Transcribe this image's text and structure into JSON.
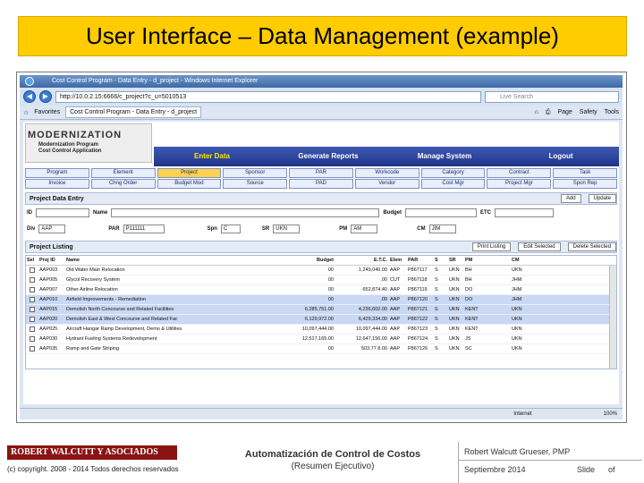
{
  "slide": {
    "title": "User Interface – Data Management (example)"
  },
  "browser": {
    "window_title": "Cost Control Program - Data Entry - d_project - Windows Internet Explorer",
    "address": "http://10.0.2.15:6666/c_project?c_u=5010513",
    "search_placeholder": "Live Search",
    "favorites": "Favorites",
    "tab_label": "Cost Control Program - Data Entry - d_project",
    "tools": [
      "Page",
      "Safety",
      "Tools"
    ],
    "status_internet": "Internet",
    "status_zoom": "100%"
  },
  "app": {
    "logo_title": "MODERNIZATION",
    "logo_sub1": "Modernization Program",
    "logo_sub2": "Cost Control Application",
    "menu": [
      "Enter Data",
      "Generate Reports",
      "Manage System",
      "Logout"
    ],
    "nav_row1": [
      "Program",
      "Element",
      "Project",
      "Sponsor",
      "PAR",
      "Workcode",
      "Category",
      "Contract",
      "Task"
    ],
    "nav_row2": [
      "Invoice",
      "Chng Order",
      "Budget Mod",
      "Source",
      "PAD",
      "Vendor",
      "Cost Mgr",
      "Project Mgr",
      "Spon Rep"
    ],
    "entry_title": "Project Data Entry",
    "add_label": "Add",
    "update_label": "Update",
    "fields_row1": {
      "id": "ID",
      "name": "Name",
      "budget": "Budget",
      "etc": "ETC"
    },
    "fields_row2": {
      "div": "Div",
      "div_val": "AAP",
      "par": "PAR",
      "par_val": "P111111",
      "spn": "Spn",
      "spn_val": "C",
      "sr": "SR",
      "sr_val": "UKN",
      "pm": "PM",
      "pm_val": "AM",
      "cm": "CM",
      "cm_val": "JIM"
    },
    "listing_title": "Project Listing",
    "print_label": "Print Listing",
    "edit_label": "Edit Selected",
    "delete_label": "Delete Selected",
    "columns": [
      "Sel",
      "Proj ID",
      "Name",
      "Budget",
      "E.T.C.",
      "Elem",
      "PAR",
      "S",
      "SR",
      "PM",
      "CM"
    ],
    "rows": [
      {
        "id": "AAP003",
        "name": "Old Water Main Relocation",
        "budget": "00",
        "etc": "1,249,040.00",
        "elem": "AAP",
        "par": "P867117",
        "s": "S",
        "sr": "UKN",
        "pm": "BH",
        "cm": "UKN",
        "hl": false
      },
      {
        "id": "AAP005",
        "name": "Glycol Recovery System",
        "budget": "00",
        "etc": ".00",
        "elem": "CUT",
        "par": "P867118",
        "s": "S",
        "sr": "UKN",
        "pm": "BH",
        "cm": "JHM",
        "hl": false
      },
      {
        "id": "AAP007",
        "name": "Other Airline Relocation",
        "budget": "00",
        "etc": "652,874.40",
        "elem": "AAP",
        "par": "P867119",
        "s": "S",
        "sr": "UKN",
        "pm": "DO",
        "cm": "JHM",
        "hl": false
      },
      {
        "id": "AAP010",
        "name": "Airfield Improvements - Remediation",
        "budget": "00",
        "etc": ".00",
        "elem": "AAP",
        "par": "P867120",
        "s": "S",
        "sr": "UKN",
        "pm": "DO",
        "cm": "JHM",
        "hl": true
      },
      {
        "id": "AAP015",
        "name": "Demolish North Concourse and Related Facilities",
        "budget": "6,285,751.00",
        "etc": "4,236,602.00",
        "elem": "AAP",
        "par": "P867121",
        "s": "S",
        "sr": "UKN",
        "pm": "KENT",
        "cm": "UKN",
        "hl": true
      },
      {
        "id": "AAP020",
        "name": "Demolish East & West Concourse and Related Fac",
        "budget": "6,129,972.00",
        "etc": "6,429,334.00",
        "elem": "AAP",
        "par": "P867122",
        "s": "S",
        "sr": "UKN",
        "pm": "KENT",
        "cm": "UKN",
        "hl": true
      },
      {
        "id": "AAP025",
        "name": "Aircraft Hangar Ramp Development, Demo & Utilities",
        "budget": "10,097,444.00",
        "etc": "10,097,444.00",
        "elem": "AAP",
        "par": "P867123",
        "s": "S",
        "sr": "UKN",
        "pm": "KENT",
        "cm": "UKN",
        "hl": false
      },
      {
        "id": "AAP030",
        "name": "Hydrant Fueling Systems Redevelopment",
        "budget": "12,517,165.00",
        "etc": "12,647,156.00",
        "elem": "AAP",
        "par": "P867124",
        "s": "S",
        "sr": "UKN",
        "pm": "JS",
        "cm": "UKN",
        "hl": false
      },
      {
        "id": "AAP035",
        "name": "Ramp and Gate Striping",
        "budget": "00",
        "etc": "503.77 8.00",
        "elem": "AAP",
        "par": "P867126",
        "s": "S",
        "sr": "UKN",
        "pm": "SC",
        "cm": "UKN",
        "hl": false
      }
    ]
  },
  "footer": {
    "company": "ROBERT WALCUTT Y ASOCIADOS",
    "copyright": "(c) copyright. 2008 - 2014 Todos derechos reservados",
    "title": "Automatización de Control de Costos",
    "subtitle": "(Resumen Ejecutivo)",
    "author": "Robert Walcutt Grueser, PMP",
    "date": "Septiembre 2014",
    "slide": "Slide",
    "of": "of"
  }
}
